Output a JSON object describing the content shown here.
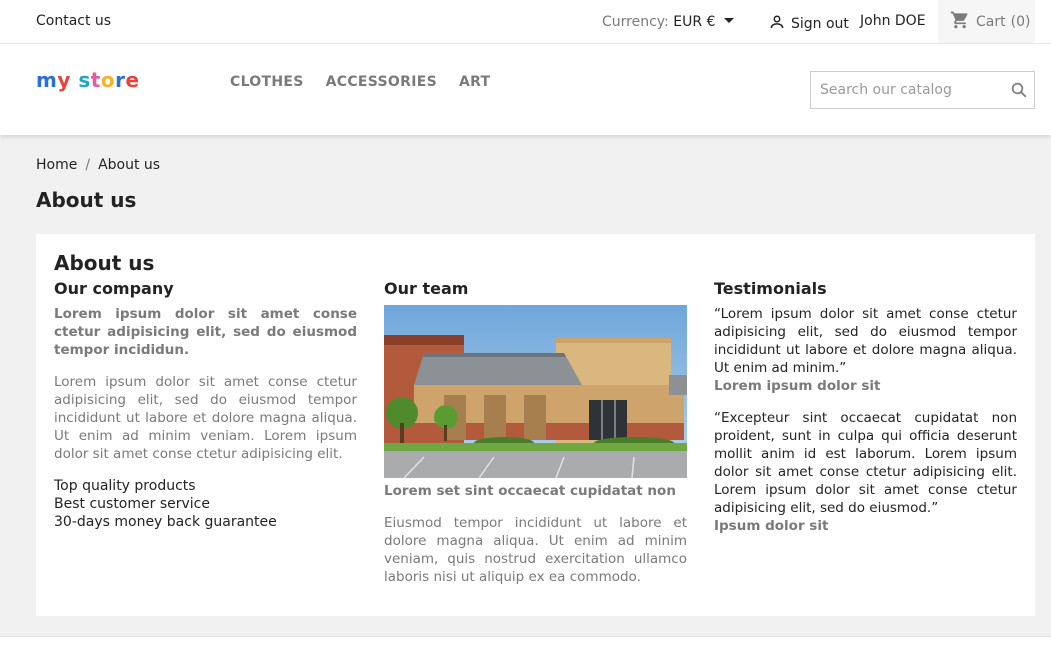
{
  "topbar": {
    "contact": "Contact us",
    "currency_label": "Currency:",
    "currency_value": "EUR €",
    "signout": "Sign out",
    "username": "John DOE",
    "cart_label": "Cart",
    "cart_count": "(0)"
  },
  "header": {
    "logo_text": "my store",
    "nav": [
      "CLOTHES",
      "ACCESSORIES",
      "ART"
    ],
    "search_placeholder": "Search our catalog"
  },
  "breadcrumb": [
    "Home",
    "About us"
  ],
  "page_title": "About us",
  "content": {
    "heading": "About us",
    "company": {
      "title": "Our company",
      "lead": "Lorem ipsum dolor sit amet conse ctetur adipisicing elit, sed do eiusmod tempor incididun.",
      "body": "Lorem ipsum dolor sit amet conse ctetur adipisicing elit, sed do eiusmod tempor incididunt ut labore et dolore magna aliqua. Ut enim ad minim veniam. Lorem ipsum dolor sit amet conse ctetur adipisicing elit.",
      "list": [
        "Top quality products",
        "Best customer service",
        "30-days money back guarantee"
      ]
    },
    "team": {
      "title": "Our team",
      "caption": "Lorem set sint occaecat cupidatat non",
      "body": "Eiusmod tempor incididunt ut labore et dolore magna aliqua. Ut enim ad minim veniam, quis nostrud exercitation ullamco laboris nisi ut aliquip ex ea commodo."
    },
    "testimonials": {
      "title": "Testimonials",
      "items": [
        {
          "quote": "“Lorem ipsum dolor sit amet conse ctetur adipisicing elit, sed do eiusmod tempor incididunt ut labore et dolore magna aliqua. Ut enim ad minim.”",
          "author": "Lorem ipsum dolor sit"
        },
        {
          "quote": "“Excepteur sint occaecat cupidatat non proident, sunt in culpa qui officia deserunt mollit anim id est laborum. Lorem ipsum dolor sit amet conse ctetur adipisicing elit. Lorem ipsum dolor sit amet conse ctetur adipisicing elit, sed do eiusmod.”",
          "author": "Ipsum dolor sit"
        }
      ]
    }
  },
  "colors": {
    "page_bg": "#f1f1f1",
    "text_dark": "#232323",
    "text_muted": "#7a7a7a",
    "logo_m": "#2c6fd6",
    "logo_y": "#e8423a",
    "logo_s": "#1fa5c9",
    "logo_t": "#e85aa0",
    "logo_o": "#f0b429",
    "logo_r": "#2c6fd6",
    "logo_e": "#e8423a"
  },
  "icons": {
    "user": "user-icon",
    "cart": "shopping-cart-icon",
    "search": "search-icon",
    "caret": "caret-down-icon"
  }
}
